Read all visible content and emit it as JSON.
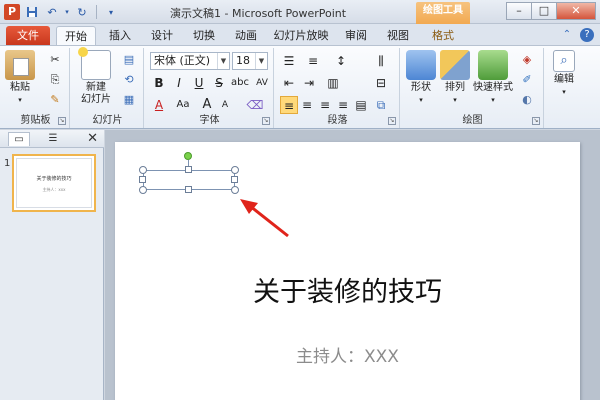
{
  "window": {
    "app_icon": "P",
    "title": "演示文稿1 - Microsoft PowerPoint",
    "contextual_tab": "绘图工具",
    "minimize": "–",
    "maximize": "□",
    "close": "✕"
  },
  "qat": {
    "save_icon": "save-icon",
    "undo_icon": "undo-icon",
    "redo_icon": "redo-icon"
  },
  "tabs": {
    "file": "文件",
    "home": "开始",
    "insert": "插入",
    "design": "设计",
    "transitions": "切换",
    "animations": "动画",
    "slideshow": "幻灯片放映",
    "review": "审阅",
    "view": "视图",
    "format": "格式"
  },
  "ribbon": {
    "clipboard": {
      "label": "剪贴板",
      "paste": "粘贴"
    },
    "slides": {
      "label": "幻灯片",
      "new_slide_1": "新建",
      "new_slide_2": "幻灯片"
    },
    "font": {
      "label": "字体",
      "font_name": "宋体 (正文)",
      "font_size": "18",
      "bold": "B",
      "italic": "I",
      "underline": "U",
      "strike": "S",
      "shadow": "abc",
      "spacing": "AV",
      "color": "A",
      "aa": "Aa",
      "grow": "A",
      "shrink": "A"
    },
    "paragraph": {
      "label": "段落"
    },
    "drawing": {
      "label": "绘图",
      "shape": "形状",
      "arrange": "排列",
      "quick_styles": "快速样式"
    },
    "editing": {
      "label": "编辑"
    }
  },
  "panel": {
    "slide_number": "1",
    "thumb_title": "关于装修的技巧",
    "thumb_sub": "主持人：xxx"
  },
  "slide": {
    "title": "关于装修的技巧",
    "subtitle": "主持人：XXX"
  },
  "colors": {
    "file_tab": "#d24726",
    "contextual": "#f2a951",
    "annotation_arrow": "#e0241b"
  }
}
